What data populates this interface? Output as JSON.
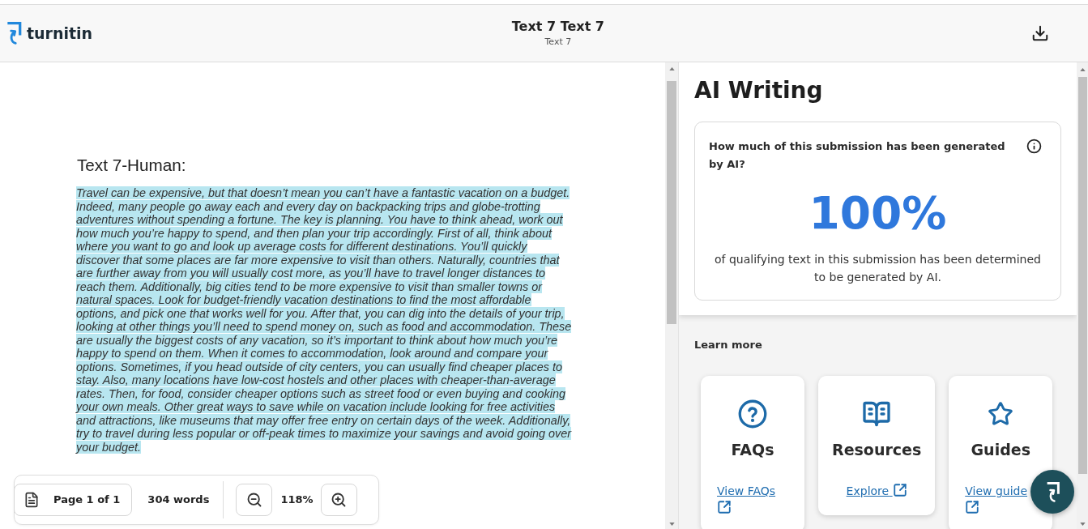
{
  "header": {
    "logo_text": "turnitin",
    "title": "Text 7 Text 7",
    "subtitle": "Text 7"
  },
  "document": {
    "heading": "Text 7-Human:",
    "paragraph": "Travel can be expensive, but that doesn’t mean you can’t have a fantastic vacation on a budget. Indeed, many people go away each and every day on backpacking trips and globe-trotting adventures without spending a fortune. The key is planning. You have to think ahead, work out how much you’re happy to spend, and then plan your trip accordingly. First of all, think about where you want to go and look up average costs for different destinations. You’ll quickly discover that some places are far more expensive to visit than others. Naturally, countries that are further away from you will usually cost more, as you’ll have to travel longer distances to reach them. Additionally, big cities tend to be more expensive to visit than smaller towns or natural spaces. Look for budget-friendly vacation destinations to find the most affordable options, and pick one that works well for you. After that, you can dig into the details of your trip, looking at other things you’ll need to spend money on, such as food and accommodation. These are usually the biggest costs of any vacation, so it’s important to think about how much you’re happy to spend on them. When it comes to accommodation, look around and compare your options. Sometimes, if you head outside of city centers, you can usually find cheaper places to stay. Also, many locations have low-cost hostels and other places with cheaper-than-average rates. Then, for food, consider cheaper options such as street food or even buying and cooking your own meals. Other great ways to save while on vacation include looking for free activities and attractions, like museums that may offer free entry on certain days of the week. Additionally, try to travel during less popular or off-peak times to maximize your savings and avoid going over your budget.",
    "highlighted": true
  },
  "toolbar": {
    "page": "Page 1 of 1",
    "word_count": "304 words",
    "zoom": "118%"
  },
  "ai_writing": {
    "title": "AI Writing",
    "question": "How much of this submission has been generated by AI?",
    "percentage": "100%",
    "description": "of qualifying text in this submission has been determined to be generated by AI."
  },
  "learn_more": {
    "title": "Learn more",
    "cards": [
      {
        "kind": "faq",
        "title": "FAQs",
        "link": "View FAQs"
      },
      {
        "kind": "resources",
        "title": "Resources",
        "link": "Explore"
      },
      {
        "kind": "guides",
        "title": "Guides",
        "link": "View guide"
      }
    ]
  }
}
